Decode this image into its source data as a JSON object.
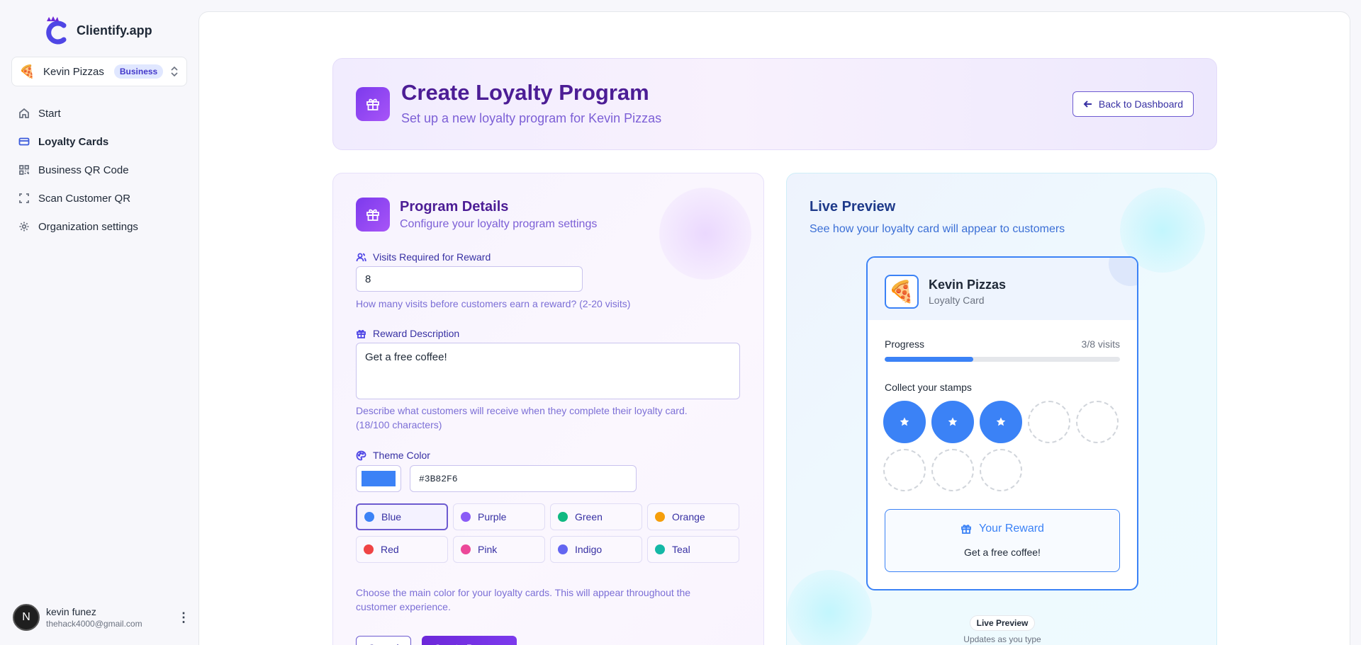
{
  "app": {
    "name": "Clientify.app"
  },
  "org": {
    "emoji": "🍕",
    "name": "Kevin Pizzas",
    "badge": "Business"
  },
  "nav": {
    "items": [
      {
        "label": "Start",
        "icon": "home-icon"
      },
      {
        "label": "Loyalty Cards",
        "icon": "credit-card-icon",
        "active": true
      },
      {
        "label": "Business QR Code",
        "icon": "qr-code-icon"
      },
      {
        "label": "Scan Customer QR",
        "icon": "scan-icon"
      },
      {
        "label": "Organization settings",
        "icon": "gear-icon"
      }
    ]
  },
  "user": {
    "initial": "N",
    "name": "kevin funez",
    "email": "thehack4000@gmail.com",
    "menu": "⋮"
  },
  "header": {
    "title": "Create Loyalty Program",
    "subtitle": "Set up a new loyalty program for Kevin Pizzas",
    "back_label": "Back to Dashboard"
  },
  "form": {
    "title": "Program Details",
    "subtitle": "Configure your loyalty program settings",
    "visits_label": "Visits Required for Reward",
    "visits_value": "8",
    "visits_hint": "How many visits before customers earn a reward? (2-20 visits)",
    "reward_label": "Reward Description",
    "reward_value": "Get a free coffee!",
    "reward_hint_1": "Describe what customers will receive when they complete their loyalty card.",
    "reward_hint_2": "(18/100 characters)",
    "theme_label": "Theme Color",
    "theme_hex": "#3B82F6",
    "colors": [
      {
        "name": "Blue",
        "hex": "#3b82f6",
        "selected": true
      },
      {
        "name": "Purple",
        "hex": "#8b5cf6"
      },
      {
        "name": "Green",
        "hex": "#10b981"
      },
      {
        "name": "Orange",
        "hex": "#f59e0b"
      },
      {
        "name": "Red",
        "hex": "#ef4444"
      },
      {
        "name": "Pink",
        "hex": "#ec4899"
      },
      {
        "name": "Indigo",
        "hex": "#6366f1"
      },
      {
        "name": "Teal",
        "hex": "#14b8a6"
      }
    ],
    "theme_hint_1": "Choose the main color for your loyalty cards. This will appear throughout the",
    "theme_hint_2": "customer experience.",
    "cancel_label": "Cancel",
    "create_label": "Create Program"
  },
  "preview": {
    "title": "Live Preview",
    "subtitle": "See how your loyalty card will appear to customers",
    "card": {
      "logo": "🍕",
      "business": "Kevin Pizzas",
      "type": "Loyalty Card",
      "progress_label": "Progress",
      "progress_count": "3/8 visits",
      "progress_value": 0.375,
      "stamps_label": "Collect your stamps",
      "stamps_total": 8,
      "stamps_filled": 3,
      "reward_title": "Your Reward",
      "reward_text": "Get a free coffee!"
    },
    "badge": "Live Preview",
    "note": "Updates as you type"
  },
  "colors": {
    "accent": "#3b82f6",
    "brand_purple": "#7c3aed"
  }
}
